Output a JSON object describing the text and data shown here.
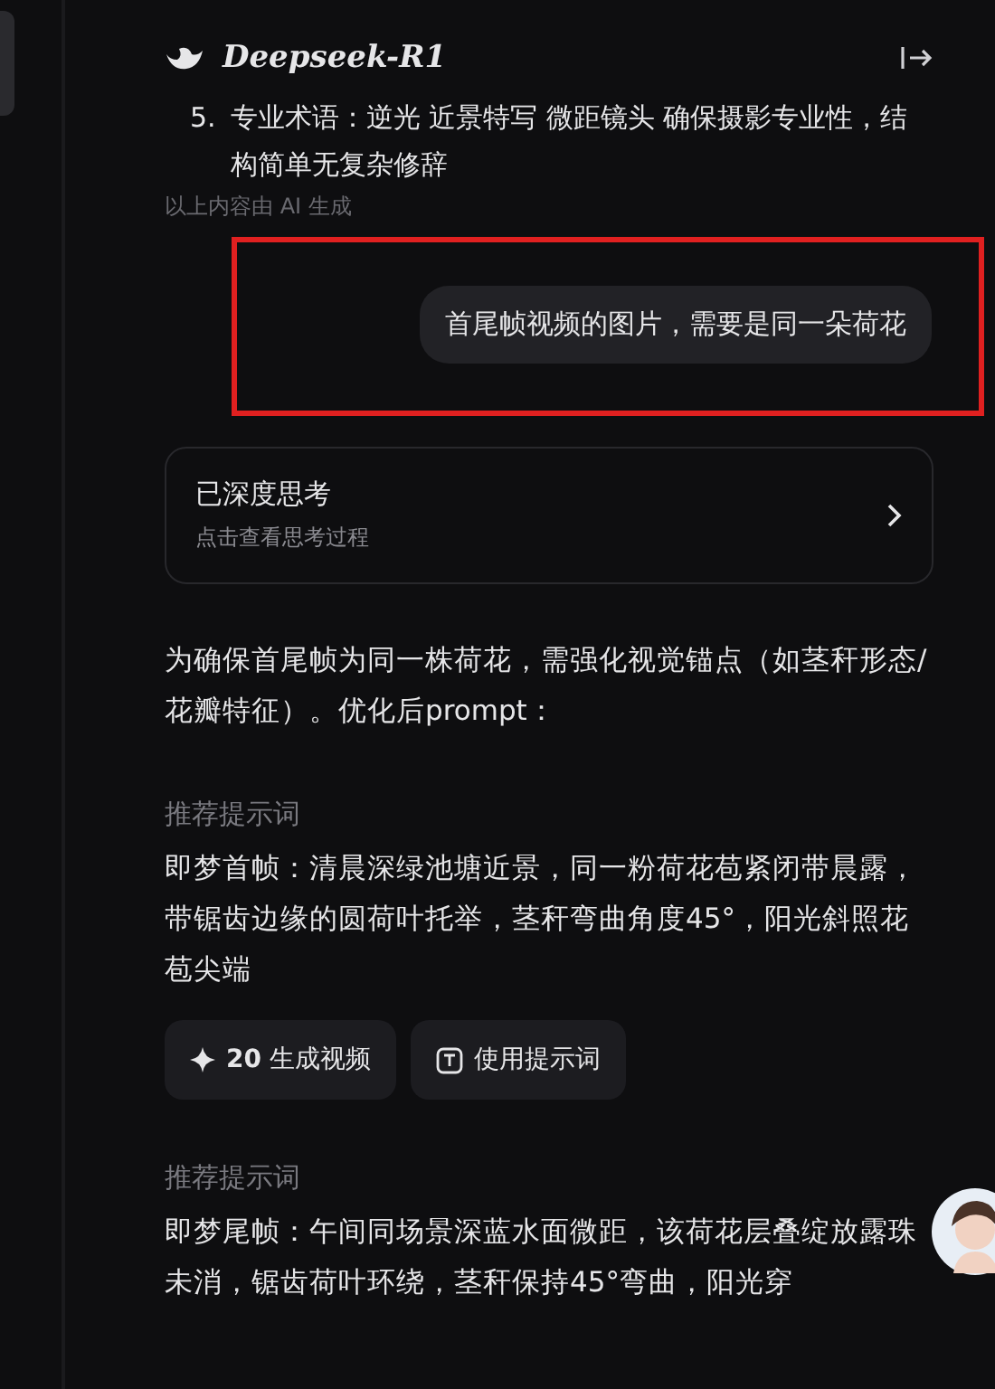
{
  "header": {
    "title": "Deepseek-R1"
  },
  "previous_answer": {
    "number": "5.",
    "text": "专业术语：逆光 近景特写 微距镜头 确保摄影专业性，结构简单无复杂修辞"
  },
  "ai_note": "以上内容由 AI 生成",
  "user_message": {
    "text": "首尾帧视频的图片，需要是同一朵荷花",
    "highlighted": true
  },
  "thinking": {
    "title": "已深度思考",
    "subtitle": "点击查看思考过程"
  },
  "answer_intro": "为确保首尾帧为同一株荷花，需强化视觉锚点（如茎秆形态/花瓣特征）。优化后prompt：",
  "prompts": [
    {
      "heading": "推荐提示词",
      "text": "即梦首帧：清晨深绿池塘近景，同一粉荷花苞紧闭带晨露，带锯齿边缘的圆荷叶托举，茎秆弯曲角度45°，阳光斜照花苞尖端",
      "buttons": [
        {
          "kind": "generate",
          "label": "**20** 生成视频"
        },
        {
          "kind": "use",
          "label": "使用提示词"
        }
      ]
    },
    {
      "heading": "推荐提示词",
      "text": "即梦尾帧：午间同场景深蓝水面微距，该荷花层叠绽放露珠未消，锯齿荷叶环绕，茎秆保持45°弯曲，阳光穿"
    }
  ]
}
